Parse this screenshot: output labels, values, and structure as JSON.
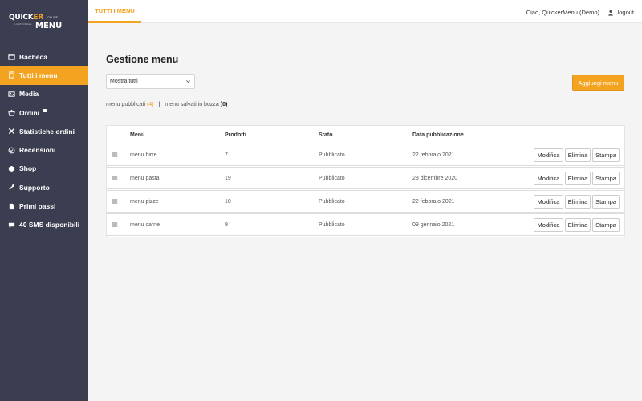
{
  "brand": {
    "logo_top": "QUICK",
    "logo_er": "ER",
    "logo_bottom": "MENU",
    "logo_online": "ONLINE",
    "logo_tagline": "IL GESTIONALE",
    "accent_color": "#f4a320",
    "sidebar_color": "#3b3d50"
  },
  "sidebar": {
    "items": [
      {
        "label": "Bacheca",
        "icon": "calendar-icon"
      },
      {
        "label": "Tutti i menu",
        "icon": "book-icon",
        "active": true
      },
      {
        "label": "Media",
        "icon": "image-icon"
      },
      {
        "label": "Ordini",
        "icon": "basket-icon"
      },
      {
        "label": "Statistiche ordini",
        "icon": "tools-icon"
      },
      {
        "label": "Recensioni",
        "icon": "check-circle-icon"
      },
      {
        "label": "Shop",
        "icon": "box-icon"
      },
      {
        "label": "Supporto",
        "icon": "wrench-icon"
      },
      {
        "label": "Primi passi",
        "icon": "document-icon"
      },
      {
        "label": "40 SMS disponibili",
        "icon": "chat-icon"
      }
    ]
  },
  "topbar": {
    "tab": "TUTTI I MENU",
    "greeting": "Ciao, QuickerMenu (Demo)",
    "logout": "logout"
  },
  "main": {
    "title": "Gestione menu",
    "filter_select": "Mostra tutti",
    "add_button": "Aggiungi menu",
    "published_label": "menu pubblicati",
    "published_count": "(4)",
    "separator": "|",
    "draft_label": "menu salvati in bozza",
    "draft_count": "(0)"
  },
  "table": {
    "columns": [
      "Menu",
      "Prodotti",
      "Stato",
      "Data pubblicazione"
    ],
    "actions": [
      "Modifica",
      "Elimina",
      "Stampa"
    ],
    "rows": [
      {
        "menu": "menu birre",
        "prodotti": "7",
        "stato": "Pubblicato",
        "data": "22 febbraio 2021"
      },
      {
        "menu": "menu pasta",
        "prodotti": "19",
        "stato": "Pubblicato",
        "data": "28 dicembre 2020"
      },
      {
        "menu": "menu pizze",
        "prodotti": "10",
        "stato": "Pubblicato",
        "data": "22 febbraio 2021"
      },
      {
        "menu": "menu carne",
        "prodotti": "9",
        "stato": "Pubblicato",
        "data": "09 gennaio 2021"
      }
    ]
  }
}
